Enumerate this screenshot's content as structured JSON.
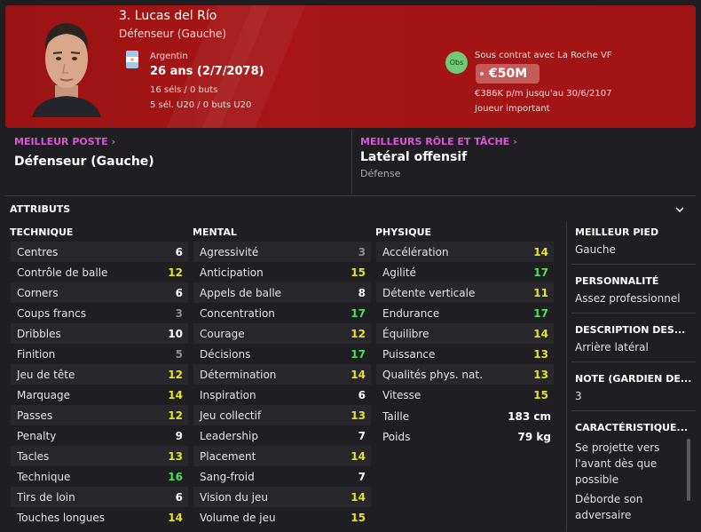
{
  "player": {
    "name": "3. Lucas del Río",
    "role": "Défenseur (Gauche)",
    "country": "Argentin",
    "age": "26 ans (2/7/2078)",
    "caps": "16 séls / 0 buts",
    "caps_u20": "5 sél. U20 / 0 buts U20"
  },
  "contract": {
    "badge": "Obs",
    "club": "Sous contrat avec La Roche VF",
    "value": "€50M",
    "wage": "€386K p/m jusqu'au 30/6/2107",
    "status": "Joueur important"
  },
  "best_position": {
    "label": "MEILLEUR POSTE",
    "value": "Défenseur (Gauche)"
  },
  "best_role": {
    "label": "MEILLEURS RÔLE ET TÂCHE",
    "value": "Latéral offensif",
    "sub": "Défense"
  },
  "attributes": {
    "title": "ATTRIBUTS",
    "technique": {
      "header": "TECHNIQUE",
      "items": [
        {
          "label": "Centres",
          "value": "6",
          "color": "white"
        },
        {
          "label": "Contrôle de balle",
          "value": "12",
          "color": "yellow"
        },
        {
          "label": "Corners",
          "value": "6",
          "color": "white"
        },
        {
          "label": "Coups francs",
          "value": "3",
          "color": "gray"
        },
        {
          "label": "Dribbles",
          "value": "10",
          "color": "white"
        },
        {
          "label": "Finition",
          "value": "5",
          "color": "gray"
        },
        {
          "label": "Jeu de tête",
          "value": "12",
          "color": "yellow"
        },
        {
          "label": "Marquage",
          "value": "14",
          "color": "yellow"
        },
        {
          "label": "Passes",
          "value": "12",
          "color": "yellow"
        },
        {
          "label": "Penalty",
          "value": "9",
          "color": "white"
        },
        {
          "label": "Tacles",
          "value": "13",
          "color": "yellow"
        },
        {
          "label": "Technique",
          "value": "16",
          "color": "green"
        },
        {
          "label": "Tirs de loin",
          "value": "6",
          "color": "white"
        },
        {
          "label": "Touches longues",
          "value": "14",
          "color": "yellow"
        }
      ]
    },
    "mental": {
      "header": "MENTAL",
      "items": [
        {
          "label": "Agressivité",
          "value": "3",
          "color": "gray"
        },
        {
          "label": "Anticipation",
          "value": "15",
          "color": "yellow"
        },
        {
          "label": "Appels de balle",
          "value": "8",
          "color": "white"
        },
        {
          "label": "Concentration",
          "value": "17",
          "color": "green"
        },
        {
          "label": "Courage",
          "value": "12",
          "color": "yellow"
        },
        {
          "label": "Décisions",
          "value": "17",
          "color": "green"
        },
        {
          "label": "Détermination",
          "value": "14",
          "color": "yellow"
        },
        {
          "label": "Inspiration",
          "value": "6",
          "color": "white"
        },
        {
          "label": "Jeu collectif",
          "value": "13",
          "color": "yellow"
        },
        {
          "label": "Leadership",
          "value": "7",
          "color": "white"
        },
        {
          "label": "Placement",
          "value": "14",
          "color": "yellow"
        },
        {
          "label": "Sang-froid",
          "value": "7",
          "color": "white"
        },
        {
          "label": "Vision du jeu",
          "value": "14",
          "color": "yellow"
        },
        {
          "label": "Volume de jeu",
          "value": "15",
          "color": "yellow"
        }
      ]
    },
    "physique": {
      "header": "PHYSIQUE",
      "items": [
        {
          "label": "Accélération",
          "value": "14",
          "color": "yellow"
        },
        {
          "label": "Agilité",
          "value": "17",
          "color": "green"
        },
        {
          "label": "Détente verticale",
          "value": "11",
          "color": "yellow"
        },
        {
          "label": "Endurance",
          "value": "17",
          "color": "green"
        },
        {
          "label": "Équilibre",
          "value": "14",
          "color": "yellow"
        },
        {
          "label": "Puissance",
          "value": "13",
          "color": "yellow"
        },
        {
          "label": "Qualités phys. nat.",
          "value": "13",
          "color": "yellow"
        },
        {
          "label": "Vitesse",
          "value": "15",
          "color": "yellow"
        }
      ],
      "height_label": "Taille",
      "height_value": "183 cm",
      "weight_label": "Poids",
      "weight_value": "79 kg"
    }
  },
  "side": {
    "best_foot_head": "MEILLEUR PIED",
    "best_foot": "Gauche",
    "personality_head": "PERSONNALITÉ",
    "personality": "Assez professionnel",
    "description_head": "DESCRIPTION DES...",
    "description": "Arrière latéral",
    "rating_head": "NOTE (GARDIEN DE...",
    "rating": "3",
    "traits_head": "CARACTÉRISTIQUE...",
    "trait_1a": "Se projette vers",
    "trait_1b": "l'avant dès que",
    "trait_1c": "possible",
    "trait_2a": "Déborde son",
    "trait_2b": "adversaire"
  }
}
